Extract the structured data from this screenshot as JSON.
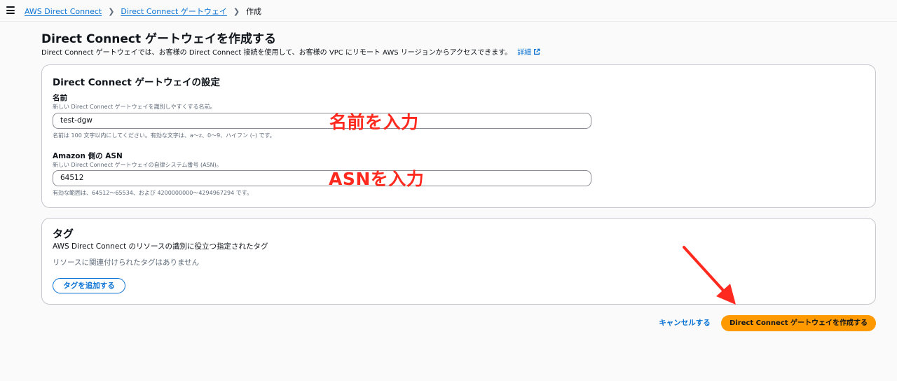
{
  "topbar": {
    "breadcrumbs": [
      {
        "label": "AWS Direct Connect"
      },
      {
        "label": "Direct Connect ゲートウェイ"
      },
      {
        "label": "作成"
      }
    ]
  },
  "header": {
    "title": "Direct Connect ゲートウェイを作成する",
    "description": "Direct Connect ゲートウェイでは、お客様の Direct Connect 接続を使用して、お客様の VPC にリモート AWS リージョンからアクセスできます。",
    "info_link": "詳細"
  },
  "settings": {
    "title": "Direct Connect ゲートウェイの設定",
    "name": {
      "label": "名前",
      "description": "新しい Direct Connect ゲートウェイを識別しやすくする名前。",
      "value": "test-dgw",
      "constraint": "名前は 100 文字以内にしてください。有効な文字は、a〜z、0〜9、ハイフン (–) です。"
    },
    "asn": {
      "label": "Amazon 側の ASN",
      "description": "新しい Direct Connect ゲートウェイの自律システム番号 (ASN)。",
      "value": "64512",
      "constraint": "有効な範囲は、64512〜65534、および 4200000000〜4294967294 です。"
    }
  },
  "tags": {
    "title": "タグ",
    "description": "AWS Direct Connect のリソースの識別に役立つ指定されたタグ",
    "empty_text": "リソースに関連付けられたタグはありません",
    "add_button": "タグを追加する"
  },
  "footer": {
    "cancel_label": "キャンセルする",
    "create_label": "Direct Connect ゲートウェイを作成する"
  },
  "annotations": {
    "name_hint": "名前を入力",
    "asn_hint": "ASNを入力"
  },
  "colors": {
    "link": "#0972d3",
    "primary_button": "#ff9900",
    "annotation": "#ff2a1f"
  }
}
